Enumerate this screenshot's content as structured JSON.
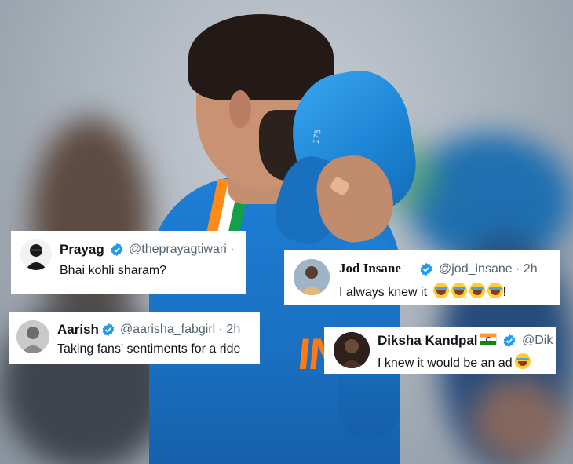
{
  "tweets": [
    {
      "name": "Prayag",
      "handle": "@theprayagtiwari ·",
      "text": "Bhai kohli sharam?"
    },
    {
      "name": "Jod Insane",
      "handle": "@jod_insane · 2h",
      "text": "I always knew it",
      "suffix": "!"
    },
    {
      "name": "Aarish",
      "handle": "@aarisha_fabgirl · 2h",
      "text": "Taking fans' sentiments for a ride"
    },
    {
      "name": "Diksha Kandpal",
      "handle": "@Dik",
      "text": "I knew it would be an ad"
    }
  ],
  "photo": {
    "cap_number": "175",
    "jersey_text": "IN"
  },
  "colors": {
    "verified": "#1d9bf0",
    "jersey": "#1a6fc0",
    "accent": "#ff7a12"
  }
}
